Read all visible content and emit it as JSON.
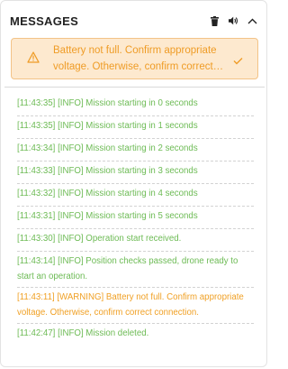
{
  "panel": {
    "title": "MESSAGES",
    "icons": [
      "trash-icon",
      "speaker-icon",
      "chevron-up-icon"
    ]
  },
  "alert": {
    "text": "Battery not full. Confirm appropriate voltage. Otherwise, confirm correct connection.",
    "icon": "warning-icon",
    "action_icon": "check-icon",
    "color": "#ef9c26",
    "background": "#fde9cf"
  },
  "log": [
    {
      "text": "[11:43:35] [INFO] Mission starting in 0 seconds",
      "level": "info"
    },
    {
      "text": "[11:43:35] [INFO] Mission starting in 1 seconds",
      "level": "info"
    },
    {
      "text": "[11:43:34] [INFO] Mission starting in 2 seconds",
      "level": "info"
    },
    {
      "text": "[11:43:33] [INFO] Mission starting in 3 seconds",
      "level": "info"
    },
    {
      "text": "[11:43:32] [INFO] Mission starting in 4 seconds",
      "level": "info"
    },
    {
      "text": "[11:43:31] [INFO] Mission starting in 5 seconds",
      "level": "info"
    },
    {
      "text": "[11:43:30] [INFO] Operation start received.",
      "level": "info"
    },
    {
      "text": "[11:43:14] [INFO] Position checks passed, drone ready to start an operation.",
      "level": "info"
    },
    {
      "text": "[11:43:11] [WARNING] Battery not full. Confirm appropriate voltage. Otherwise, confirm correct connection.",
      "level": "warning"
    },
    {
      "text": "[11:42:47] [INFO] Mission deleted.",
      "level": "info"
    }
  ],
  "colors": {
    "info": "#6dbb55",
    "warning": "#f0a024"
  }
}
